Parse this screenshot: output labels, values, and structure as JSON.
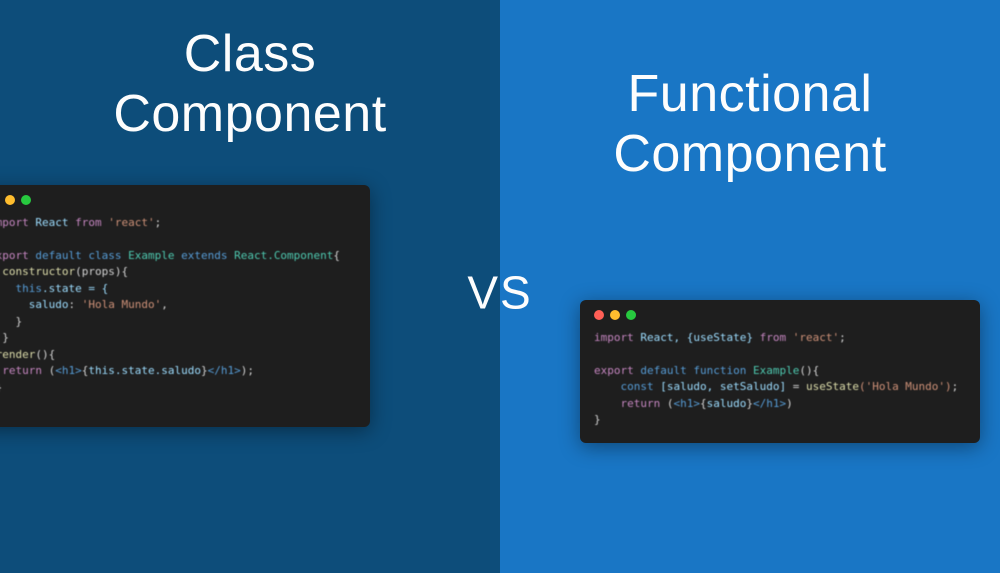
{
  "left": {
    "heading_line1": "Class",
    "heading_line2": "Component",
    "code": {
      "l1_import": "import",
      "l1_react": "React",
      "l1_from": "from",
      "l1_pkg": "'react'",
      "l1_semi": ";",
      "l3_export": "export",
      "l3_default": "default",
      "l3_class": "class",
      "l3_name": "Example",
      "l3_extends": "extends",
      "l3_parent": "React.Component",
      "l3_brace": "{",
      "l4_ctor": "constructor",
      "l4_params": "(props){",
      "l5_this": "this",
      "l5_state": ".state = {",
      "l6_key": "saludo",
      "l6_colon": ":",
      "l6_val": "'Hola Mundo'",
      "l6_comma": ",",
      "l7_close": "}",
      "l8_close": "}",
      "l9_render": "render",
      "l9_paren": "(){",
      "l10_return": "return",
      "l10_open": "(",
      "l10_tag_open": "<h1>",
      "l10_expr_open": "{",
      "l10_expr": "this.state.saludo",
      "l10_expr_close": "}",
      "l10_tag_close": "</h1>",
      "l10_close": ");",
      "l11_close": "}",
      "l12_close": "}"
    }
  },
  "vs": "VS",
  "right": {
    "heading_line1": "Functional",
    "heading_line2": "Component",
    "code": {
      "l1_import": "import",
      "l1_react": "React, {useState}",
      "l1_from": "from",
      "l1_pkg": "'react'",
      "l1_semi": ";",
      "l3_export": "export",
      "l3_default": "default",
      "l3_function": "function",
      "l3_name": "Example",
      "l3_paren": "(){",
      "l4_const": "const",
      "l4_destruct": "[saludo, setSaludo]",
      "l4_eq": "=",
      "l4_hook": "useState",
      "l4_arg": "('Hola Mundo')",
      "l4_semi": ";",
      "l5_return": "return",
      "l5_open": "(",
      "l5_tag_open": "<h1>",
      "l5_expr_open": "{",
      "l5_expr": "saludo",
      "l5_expr_close": "}",
      "l5_tag_close": "</h1>",
      "l5_close": ")",
      "l6_close": "}"
    }
  }
}
